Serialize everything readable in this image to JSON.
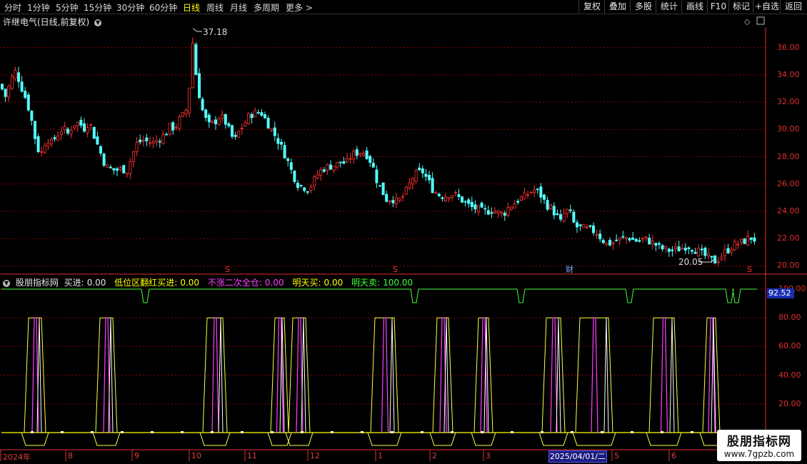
{
  "toolbar": {
    "periods": [
      "分时",
      "1分钟",
      "5分钟",
      "15分钟",
      "30分钟",
      "60分钟",
      "日线",
      "周线",
      "月线",
      "多周期",
      "更多"
    ],
    "active_period": "日线",
    "more_glyph": ">",
    "right_buttons": [
      "复权",
      "叠加",
      "多股",
      "统计",
      "画线",
      "F10",
      "标记",
      "+自选",
      "返回"
    ]
  },
  "stock": {
    "title": "许继电气(日线,前复权)",
    "high_label": "37.18",
    "low_label": "20.05",
    "event_marks": [
      "S",
      "S",
      "财",
      "S"
    ]
  },
  "indicator": {
    "name": "股朋指标网",
    "items": [
      {
        "label": "买进:",
        "value": "0.00",
        "color": "#e6e6e6"
      },
      {
        "label": "低位区翻红买进:",
        "value": "0.00",
        "color": "#ffff00"
      },
      {
        "label": "不涨二次全仓:",
        "value": "0.00",
        "color": "#ff40ff"
      },
      {
        "label": "明天买:",
        "value": "0.00",
        "color": "#ffff00"
      },
      {
        "label": "明天卖:",
        "value": "100.00",
        "color": "#40ff40"
      }
    ],
    "current_value": "92.52"
  },
  "price_axis": [
    "36.00",
    "34.00",
    "32.00",
    "30.00",
    "28.00",
    "26.00",
    "24.00",
    "22.00",
    "20.00"
  ],
  "ind_axis": [
    "100.00",
    "80.00",
    "60.00",
    "40.00",
    "20.00"
  ],
  "x_axis": [
    "2024年",
    "8",
    "9",
    "10",
    "11",
    "12",
    "1",
    "2",
    "3",
    "5",
    "6"
  ],
  "x_axis_selected": "2025/04/01/二",
  "watermark": {
    "name": "股朋指标网",
    "url": "www.7gpzb.com"
  },
  "colors": {
    "up": "#ff3232",
    "down": "#54ffff",
    "grid": "#8b0000",
    "axis": "#e03030",
    "selected": "#ffff00"
  },
  "chart_data": {
    "type": "candlestick",
    "price_range": [
      19.5,
      37.5
    ],
    "close_path": [
      [
        0,
        33.3
      ],
      [
        8,
        32.4
      ],
      [
        15,
        33.6
      ],
      [
        22,
        34.3
      ],
      [
        30,
        33.1
      ],
      [
        38,
        32.0
      ],
      [
        45,
        30.5
      ],
      [
        52,
        28.6
      ],
      [
        58,
        28.3
      ],
      [
        65,
        29.4
      ],
      [
        72,
        29.0
      ],
      [
        80,
        29.6
      ],
      [
        88,
        30.1
      ],
      [
        95,
        29.7
      ],
      [
        103,
        30.4
      ],
      [
        110,
        30.5
      ],
      [
        118,
        30.1
      ],
      [
        125,
        30.6
      ],
      [
        132,
        29.5
      ],
      [
        140,
        28.4
      ],
      [
        148,
        27.3
      ],
      [
        155,
        27.1
      ],
      [
        162,
        27.0
      ],
      [
        170,
        27.1
      ],
      [
        178,
        27.0
      ],
      [
        185,
        28.1
      ],
      [
        192,
        29.0
      ],
      [
        200,
        29.2
      ],
      [
        208,
        29.1
      ],
      [
        215,
        29.0
      ],
      [
        222,
        29.3
      ],
      [
        230,
        29.6
      ],
      [
        238,
        30.2
      ],
      [
        245,
        30.1
      ],
      [
        252,
        30.8
      ],
      [
        260,
        31.2
      ],
      [
        265,
        33.0
      ],
      [
        270,
        36.5
      ],
      [
        274,
        34.2
      ],
      [
        280,
        32.2
      ],
      [
        285,
        31.1
      ],
      [
        292,
        30.3
      ],
      [
        300,
        30.5
      ],
      [
        308,
        31.0
      ],
      [
        315,
        30.6
      ],
      [
        322,
        29.8
      ],
      [
        328,
        29.1
      ],
      [
        335,
        29.9
      ],
      [
        342,
        30.4
      ],
      [
        350,
        31.1
      ],
      [
        358,
        31.2
      ],
      [
        365,
        31.3
      ],
      [
        372,
        30.7
      ],
      [
        380,
        30.0
      ],
      [
        388,
        29.3
      ],
      [
        395,
        28.6
      ],
      [
        402,
        27.8
      ],
      [
        410,
        26.7
      ],
      [
        418,
        25.9
      ],
      [
        425,
        25.8
      ],
      [
        432,
        25.6
      ],
      [
        440,
        26.3
      ],
      [
        447,
        26.9
      ],
      [
        455,
        27.2
      ],
      [
        462,
        27.3
      ],
      [
        470,
        27.4
      ],
      [
        477,
        27.6
      ],
      [
        485,
        27.5
      ],
      [
        492,
        28.1
      ],
      [
        500,
        28.3
      ],
      [
        507,
        28.4
      ],
      [
        515,
        28.1
      ],
      [
        522,
        27.3
      ],
      [
        528,
        26.2
      ],
      [
        535,
        25.5
      ],
      [
        542,
        24.8
      ],
      [
        548,
        25.0
      ],
      [
        555,
        24.7
      ],
      [
        562,
        24.9
      ],
      [
        570,
        25.6
      ],
      [
        577,
        26.4
      ],
      [
        584,
        26.8
      ],
      [
        592,
        26.9
      ],
      [
        600,
        26.2
      ],
      [
        607,
        25.5
      ],
      [
        615,
        25.2
      ],
      [
        622,
        25.1
      ],
      [
        630,
        25.3
      ],
      [
        637,
        25.2
      ],
      [
        645,
        24.9
      ],
      [
        652,
        24.6
      ],
      [
        660,
        24.3
      ],
      [
        667,
        24.2
      ],
      [
        675,
        24.0
      ],
      [
        682,
        24.0
      ],
      [
        690,
        24.1
      ],
      [
        697,
        23.9
      ],
      [
        705,
        23.8
      ],
      [
        712,
        24.3
      ],
      [
        720,
        24.6
      ],
      [
        727,
        24.9
      ],
      [
        735,
        25.1
      ],
      [
        742,
        25.4
      ],
      [
        750,
        25.6
      ],
      [
        757,
        25.2
      ],
      [
        765,
        24.5
      ],
      [
        772,
        24.2
      ],
      [
        778,
        23.8
      ],
      [
        785,
        23.2
      ],
      [
        792,
        24.1
      ],
      [
        798,
        23.9
      ],
      [
        805,
        22.9
      ],
      [
        812,
        22.8
      ],
      [
        820,
        22.7
      ],
      [
        828,
        22.6
      ],
      [
        835,
        22.5
      ],
      [
        842,
        22.0
      ],
      [
        850,
        21.6
      ],
      [
        858,
        21.7
      ],
      [
        865,
        21.9
      ],
      [
        872,
        22.0
      ],
      [
        880,
        22.1
      ],
      [
        887,
        21.9
      ],
      [
        895,
        21.8
      ],
      [
        902,
        22.0
      ],
      [
        910,
        21.8
      ],
      [
        917,
        21.6
      ],
      [
        925,
        21.3
      ],
      [
        932,
        21.2
      ],
      [
        940,
        21.1
      ],
      [
        947,
        21.2
      ],
      [
        955,
        21.3
      ],
      [
        962,
        21.5
      ],
      [
        970,
        21.3
      ],
      [
        977,
        21.1
      ],
      [
        985,
        20.8
      ],
      [
        992,
        20.6
      ],
      [
        1000,
        20.3
      ],
      [
        1008,
        20.6
      ],
      [
        1015,
        21.0
      ],
      [
        1022,
        21.3
      ],
      [
        1030,
        21.6
      ],
      [
        1038,
        21.7
      ],
      [
        1045,
        21.9
      ],
      [
        1050,
        22.1
      ],
      [
        1058,
        21.9
      ]
    ],
    "high": 37.18,
    "low": 20.05
  }
}
